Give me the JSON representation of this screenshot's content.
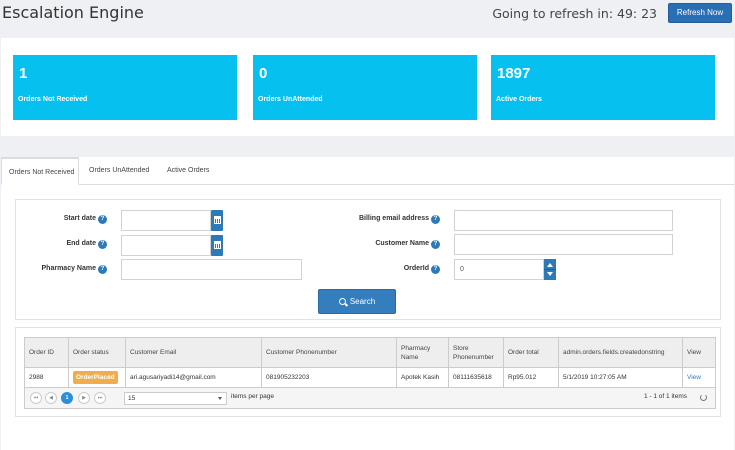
{
  "header": {
    "title": "Escalation Engine",
    "refresh_text": "Going to refresh in: 49: 23",
    "refresh_button": "Refresh Now"
  },
  "stats": [
    {
      "value": "1",
      "label": "Orders Not Received"
    },
    {
      "value": "0",
      "label": "Orders UnAttended"
    },
    {
      "value": "1897",
      "label": "Active Orders"
    }
  ],
  "tabs": [
    "Orders Not Received",
    "Orders UnAttended",
    "Active Orders"
  ],
  "filters": {
    "start_date": {
      "label": "Start date",
      "value": ""
    },
    "end_date": {
      "label": "End date",
      "value": ""
    },
    "pharmacy_name": {
      "label": "Pharmacy Name",
      "value": ""
    },
    "billing_email": {
      "label": "Billing email address",
      "value": ""
    },
    "customer_name": {
      "label": "Customer Name",
      "value": ""
    },
    "order_id": {
      "label": "OrderId",
      "value": "0"
    },
    "help_icon": "?",
    "search_button": "Search"
  },
  "grid": {
    "columns": [
      "Order ID",
      "Order status",
      "Customer Email",
      "Customer Phonenumber",
      "Pharmacy Name",
      "Store Phonenumber",
      "Order total",
      "admin.orders.fields.createdonstring",
      "View"
    ],
    "rows": [
      {
        "order_id": "2988",
        "status": "OrderPlaced",
        "email": "ari.agusariyadi14@gmail.com",
        "phone": "081905232203",
        "pharmacy": "Apotek Kasih",
        "store_phone": "08111635618",
        "total": "Rp95.012",
        "created": "5/1/2019 10:27:05 AM",
        "view": "View"
      }
    ],
    "pager": {
      "first": "⏮",
      "prev": "◀",
      "current_page": "1",
      "next": "▶",
      "last": "⏭",
      "page_size": "15",
      "items_per_page": "items per page",
      "range": "1 - 1 of 1 items"
    }
  },
  "colors": {
    "accent": "#06c1ef",
    "primary": "#2d7ab9",
    "badge": "#f0ad4e"
  }
}
